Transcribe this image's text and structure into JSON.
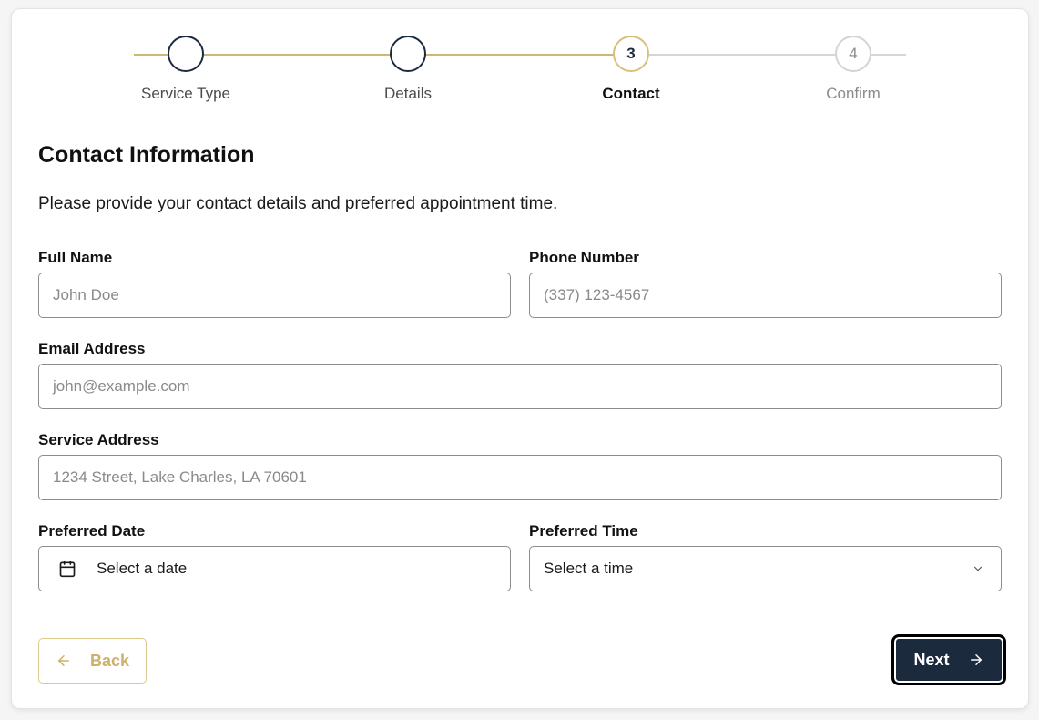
{
  "stepper": {
    "steps": [
      {
        "label": "Service Type",
        "number": "",
        "state": "done"
      },
      {
        "label": "Details",
        "number": "",
        "state": "done"
      },
      {
        "label": "Contact",
        "number": "3",
        "state": "active"
      },
      {
        "label": "Confirm",
        "number": "4",
        "state": "todo"
      }
    ]
  },
  "form": {
    "title": "Contact Information",
    "description": "Please provide your contact details and preferred appointment time.",
    "full_name": {
      "label": "Full Name",
      "placeholder": "John Doe",
      "value": ""
    },
    "phone": {
      "label": "Phone Number",
      "placeholder": "(337) 123-4567",
      "value": ""
    },
    "email": {
      "label": "Email Address",
      "placeholder": "john@example.com",
      "value": ""
    },
    "address": {
      "label": "Service Address",
      "placeholder": "1234 Street, Lake Charles, LA 70601",
      "value": ""
    },
    "date": {
      "label": "Preferred Date",
      "value": "Select a date",
      "icon": "calendar-icon"
    },
    "time": {
      "label": "Preferred Time",
      "value": "Select a time",
      "icon": "chevron-down-icon"
    }
  },
  "actions": {
    "back_label": "Back",
    "next_label": "Next"
  },
  "colors": {
    "navy": "#1c2a3e",
    "gold": "#cdb872",
    "gray": "#d6d6d6"
  }
}
